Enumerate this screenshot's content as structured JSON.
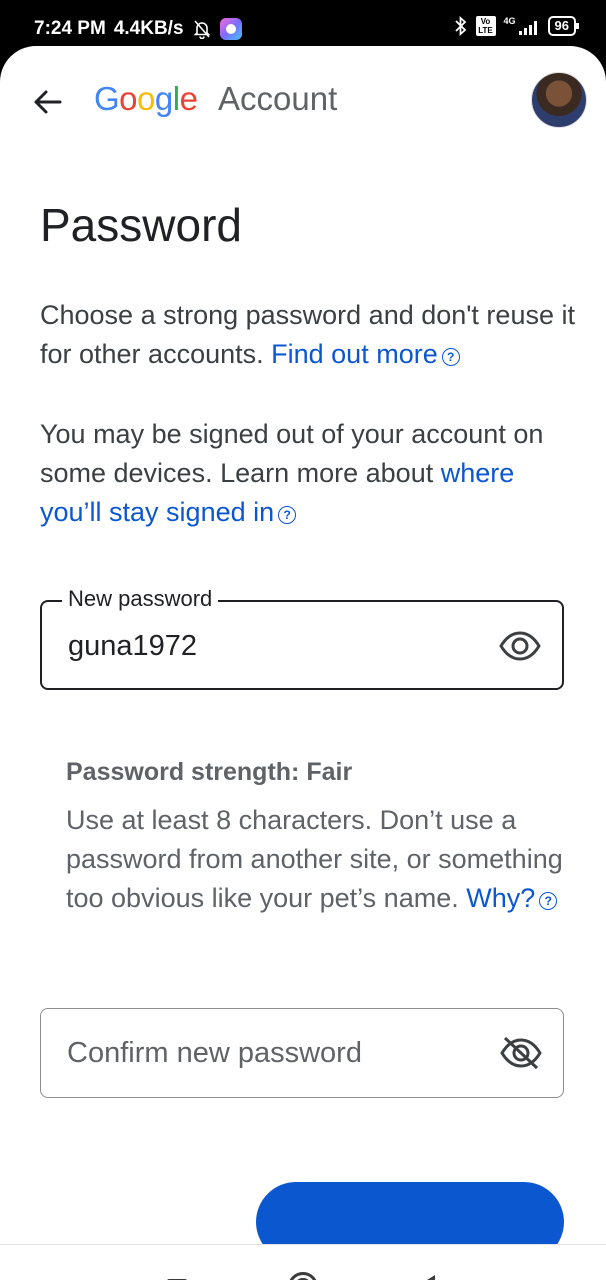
{
  "status_bar": {
    "time": "7:24 PM",
    "speed": "4.4KB/s",
    "network": "4G",
    "volte": "Vo LTE",
    "battery": "96"
  },
  "app_bar": {
    "logo_letters": [
      "G",
      "o",
      "o",
      "g",
      "l",
      "e"
    ],
    "logo_colors": [
      "#4285F4",
      "#EA4335",
      "#FBBC05",
      "#4285F4",
      "#34A853",
      "#EA4335"
    ],
    "account_word": "Account"
  },
  "page": {
    "title": "Password",
    "intro_text": "Choose a strong password and don't reuse it for other accounts.",
    "intro_link": "Find out more",
    "signout_text": "You may be signed out of your account on some devices. Learn more about",
    "signout_link": "where you’ll stay signed in"
  },
  "new_password": {
    "label": "New password",
    "value": "guna1972"
  },
  "strength": {
    "title": "Password strength: Fair",
    "text": "Use at least 8 characters. Don’t use a password from another site, or something too obvious like your pet’s name.",
    "link": "Why?"
  },
  "confirm_password": {
    "placeholder": "Confirm new password"
  },
  "colors": {
    "link": "#0b57d0",
    "primary_button": "#0b57d0"
  }
}
